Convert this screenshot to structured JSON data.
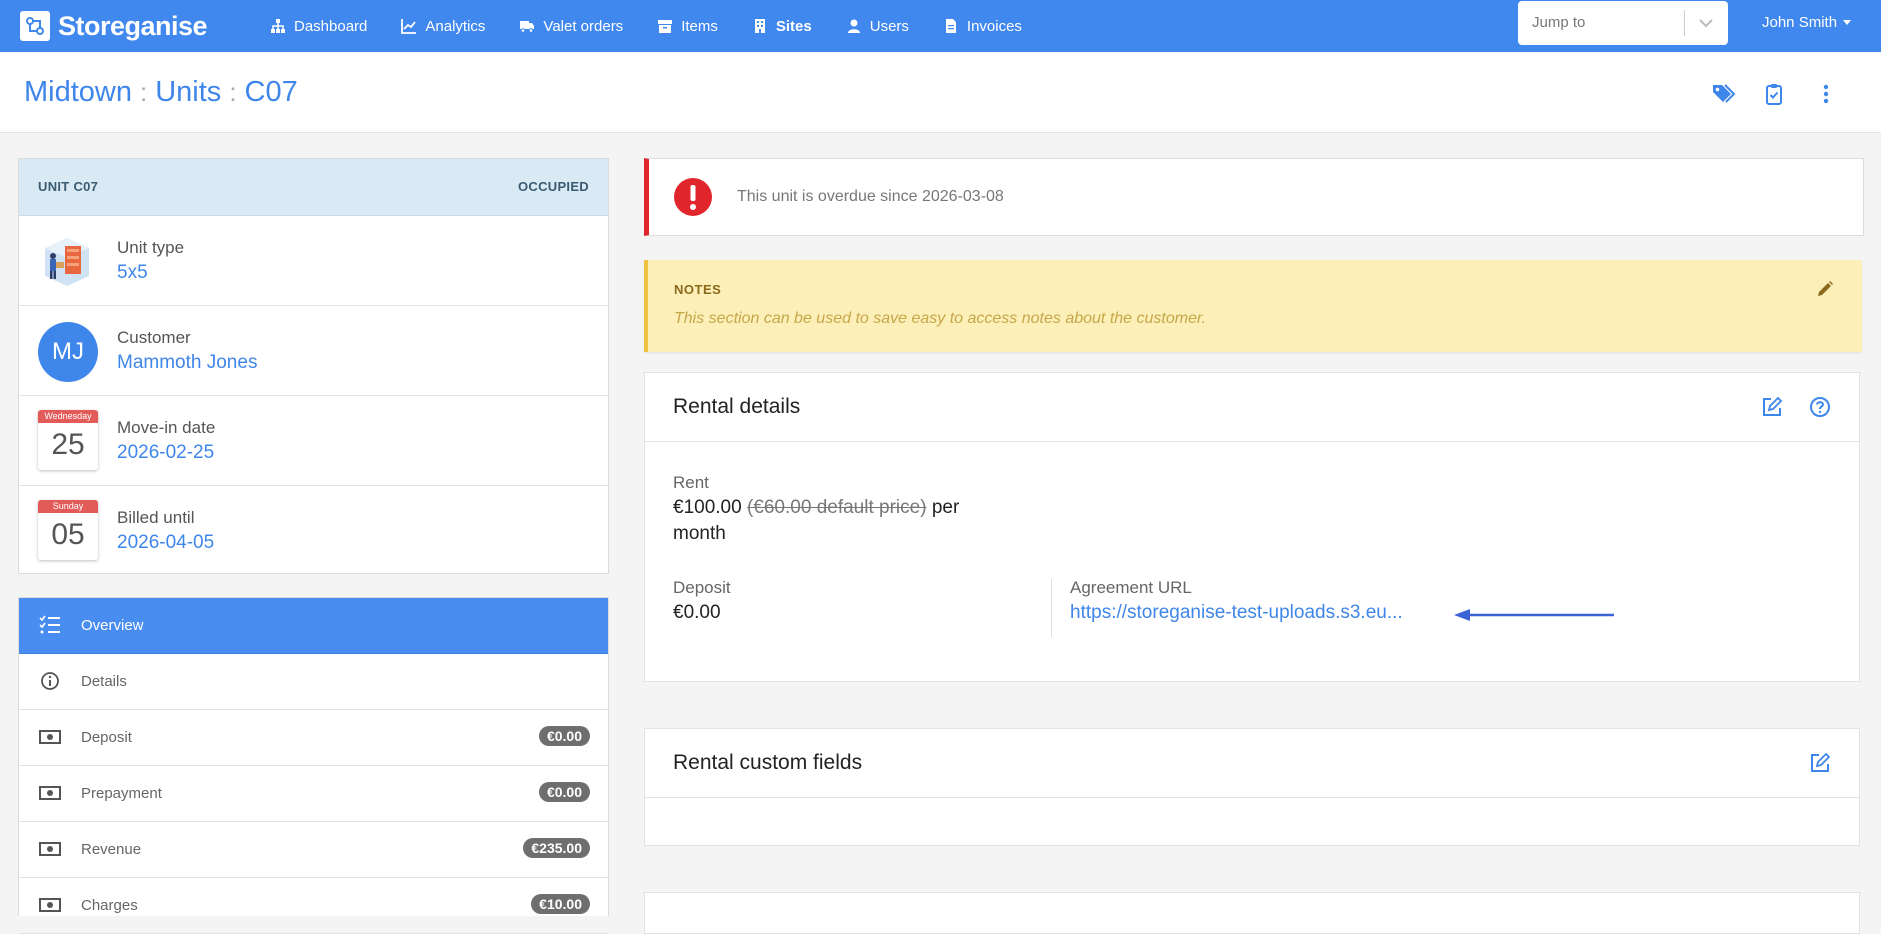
{
  "nav": {
    "brand": "Storeganise",
    "items": [
      {
        "label": "Dashboard",
        "icon": "sitemap-icon"
      },
      {
        "label": "Analytics",
        "icon": "chart-line-icon"
      },
      {
        "label": "Valet orders",
        "icon": "truck-icon"
      },
      {
        "label": "Items",
        "icon": "archive-icon"
      },
      {
        "label": "Sites",
        "icon": "building-icon",
        "active": true
      },
      {
        "label": "Users",
        "icon": "user-icon"
      },
      {
        "label": "Invoices",
        "icon": "file-icon"
      }
    ],
    "jump_placeholder": "Jump to",
    "user": "John Smith"
  },
  "header": {
    "crumbs": [
      "Midtown",
      "Units",
      "C07"
    ],
    "separator": ":"
  },
  "unit": {
    "label": "UNIT C07",
    "status": "OCCUPIED",
    "unit_type_label": "Unit type",
    "unit_type": "5x5",
    "customer_label": "Customer",
    "customer_initials": "MJ",
    "customer": "Mammoth Jones",
    "movein_label": "Move-in date",
    "movein_weekday": "Wednesday",
    "movein_day": "25",
    "movein_date": "2026-02-25",
    "billed_label": "Billed until",
    "billed_weekday": "Sunday",
    "billed_day": "05",
    "billed_date": "2026-04-05"
  },
  "menu": {
    "overview": "Overview",
    "details": "Details",
    "deposit": "Deposit",
    "deposit_badge": "€0.00",
    "prepayment": "Prepayment",
    "prepayment_badge": "€0.00",
    "revenue": "Revenue",
    "revenue_badge": "€235.00",
    "charges": "Charges",
    "charges_badge": "€10.00"
  },
  "alert": {
    "message": "This unit is overdue since 2026-03-08"
  },
  "notes": {
    "title": "NOTES",
    "body": "This section can be used to save easy to access notes about the customer."
  },
  "rental": {
    "title": "Rental details",
    "rent_label": "Rent",
    "rent_value": "€100.00",
    "rent_default": "(€60.00 default price)",
    "rent_per": "per",
    "rent_period": "month",
    "deposit_label": "Deposit",
    "deposit_value": "€0.00",
    "agreement_label": "Agreement URL",
    "agreement_url": "https://storeganise-test-uploads.s3.eu..."
  },
  "custom_fields": {
    "title": "Rental custom fields"
  },
  "colors": {
    "navbar": "#4087ee",
    "link": "#3f86ea",
    "alert": "#e0262c",
    "notes_bg": "#fcefb8"
  }
}
